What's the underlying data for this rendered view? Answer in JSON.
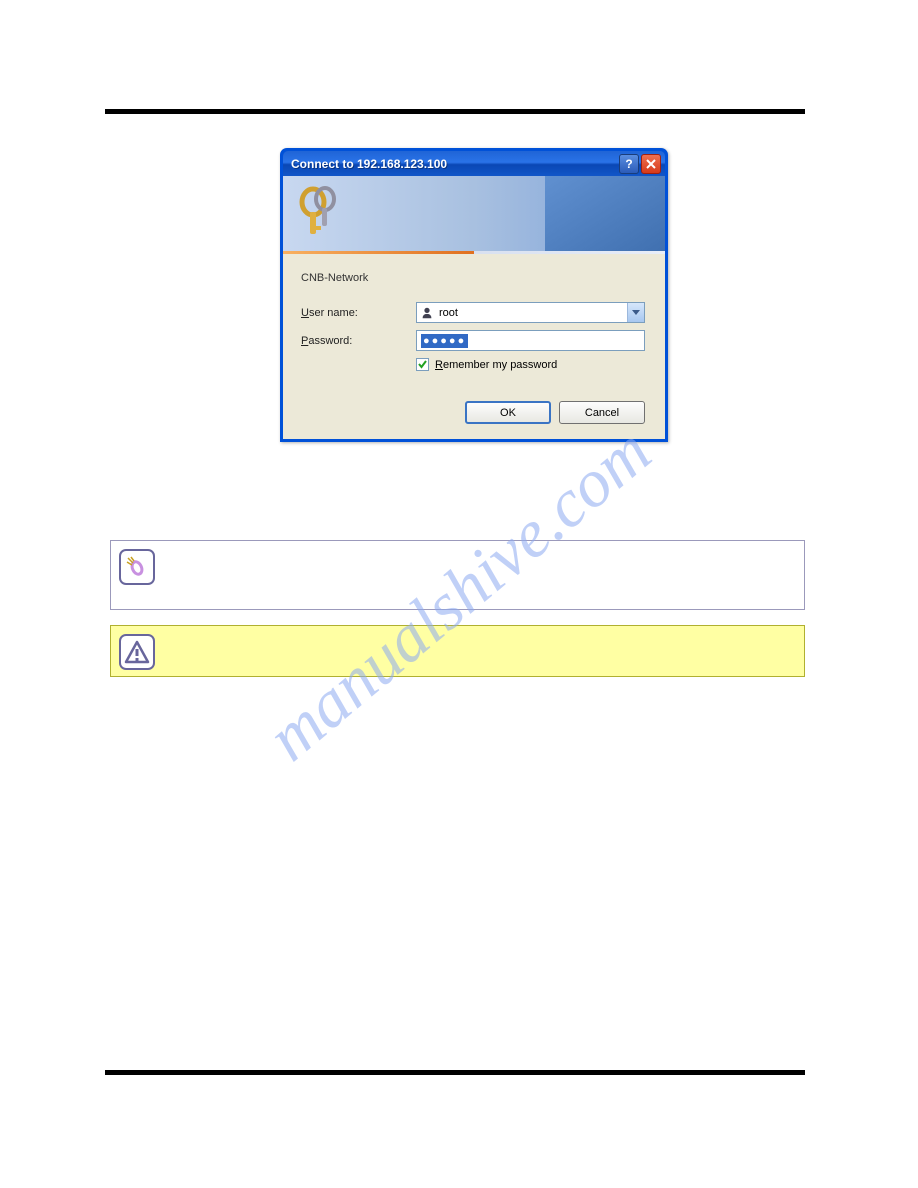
{
  "dialog": {
    "title": "Connect to 192.168.123.100",
    "realm": "CNB-Network",
    "username_label_pre": "U",
    "username_label_rest": "ser name:",
    "username_value": "root",
    "password_label_pre": "P",
    "password_label_rest": "assword:",
    "password_masked": "●●●●●",
    "remember_pre": "R",
    "remember_rest": "emember my password",
    "ok": "OK",
    "cancel": "Cancel",
    "help_glyph": "?"
  },
  "watermark": "manualshive.com"
}
